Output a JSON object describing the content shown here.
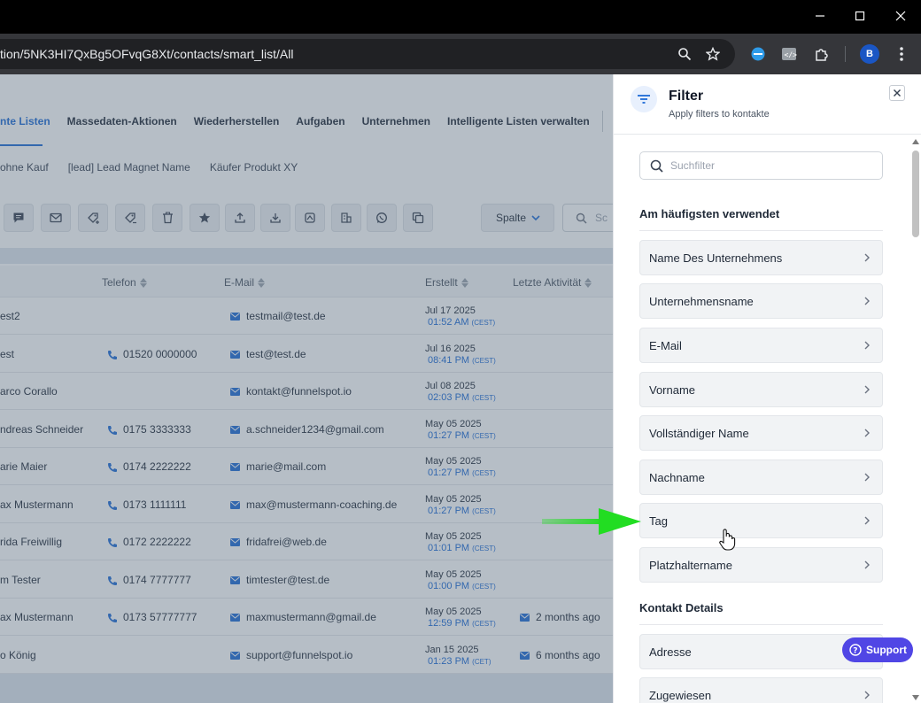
{
  "browser": {
    "url": "tion/5NK3HI7QxBg5OFvqG8Xt/contacts/smart_list/All",
    "profile_initial": "B"
  },
  "tabs": [
    {
      "label": "nte Listen",
      "active": true
    },
    {
      "label": "Massedaten-Aktionen"
    },
    {
      "label": "Wiederherstellen"
    },
    {
      "label": "Aufgaben"
    },
    {
      "label": "Unternehmen"
    },
    {
      "label": "Intelligente Listen verwalten"
    }
  ],
  "smart_lists": [
    "ohne Kauf",
    "[lead] Lead Magnet Name",
    "Käufer Produkt XY"
  ],
  "toolbar": {
    "columns_label": "Spalte",
    "search_placeholder": "Sc"
  },
  "table": {
    "headers": {
      "phone": "Telefon",
      "email": "E-Mail",
      "created": "Erstellt",
      "activity": "Letzte Aktivität"
    },
    "rows": [
      {
        "name": "est2",
        "phone": "",
        "email": "testmail@test.de",
        "date": "Jul 17 2025",
        "time": "01:52 AM",
        "tz": "(CEST)",
        "activity": ""
      },
      {
        "name": "est",
        "phone": "01520 0000000",
        "email": "test@test.de",
        "date": "Jul 16 2025",
        "time": "08:41 PM",
        "tz": "(CEST)",
        "activity": ""
      },
      {
        "name": "arco Corallo",
        "phone": "",
        "email": "kontakt@funnelspot.io",
        "date": "Jul 08 2025",
        "time": "02:03 PM",
        "tz": "(CEST)",
        "activity": ""
      },
      {
        "name": "ndreas Schneider",
        "phone": "0175 3333333",
        "email": "a.schneider1234@gmail.com",
        "date": "May 05 2025",
        "time": "01:27 PM",
        "tz": "(CEST)",
        "activity": ""
      },
      {
        "name": "arie Maier",
        "phone": "0174 2222222",
        "email": "marie@mail.com",
        "date": "May 05 2025",
        "time": "01:27 PM",
        "tz": "(CEST)",
        "activity": ""
      },
      {
        "name": "ax Mustermann",
        "phone": "0173 1111111",
        "email": "max@mustermann-coaching.de",
        "date": "May 05 2025",
        "time": "01:27 PM",
        "tz": "(CEST)",
        "activity": ""
      },
      {
        "name": "rida Freiwillig",
        "phone": "0172 2222222",
        "email": "fridafrei@web.de",
        "date": "May 05 2025",
        "time": "01:01 PM",
        "tz": "(CEST)",
        "activity": ""
      },
      {
        "name": "m Tester",
        "phone": "0174 7777777",
        "email": "timtester@test.de",
        "date": "May 05 2025",
        "time": "01:00 PM",
        "tz": "(CEST)",
        "activity": ""
      },
      {
        "name": "ax Mustermann",
        "phone": "0173 57777777",
        "email": "maxmustermann@gmail.de",
        "date": "May 05 2025",
        "time": "12:59 PM",
        "tz": "(CEST)",
        "activity": "2 months ago"
      },
      {
        "name": "o König",
        "phone": "",
        "email": "support@funnelspot.io",
        "date": "Jan 15 2025",
        "time": "01:23 PM",
        "tz": "(CET)",
        "activity": "6 months ago"
      }
    ]
  },
  "filter": {
    "title": "Filter",
    "subtitle": "Apply filters to kontakte",
    "search_placeholder": "Suchfilter",
    "section_common": "Am häufigsten verwendet",
    "common_items": [
      "Name Des Unternehmens",
      "Unternehmensname",
      "E-Mail",
      "Vorname",
      "Vollständiger Name",
      "Nachname",
      "Tag",
      "Platzhaltername"
    ],
    "section_details": "Kontakt Details",
    "detail_items": [
      "Adresse",
      "Zugewiesen"
    ],
    "support_label": "Support"
  },
  "colors": {
    "accent": "#1e6bd6",
    "support": "#5046e5",
    "arrow": "#22dd22"
  }
}
